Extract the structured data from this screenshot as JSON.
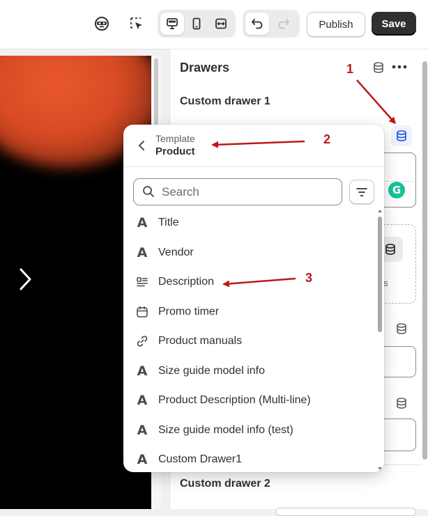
{
  "toolbar": {
    "publish_label": "Publish",
    "save_label": "Save",
    "icons": [
      "incognito-icon",
      "select-cursor-icon",
      "desktop-icon",
      "mobile-icon",
      "fullwidth-icon",
      "undo-icon",
      "redo-icon"
    ]
  },
  "sidebar": {
    "title": "Drawers",
    "section1": "Custom drawer 1",
    "section2": "Custom drawer 2",
    "dashed_text": "s"
  },
  "popover": {
    "breadcrumb_parent": "Template",
    "breadcrumb_current": "Product",
    "search_placeholder": "Search",
    "items": [
      {
        "label": "Title",
        "icon": "text-a-icon"
      },
      {
        "label": "Vendor",
        "icon": "text-a-icon"
      },
      {
        "label": "Description",
        "icon": "paragraph-icon"
      },
      {
        "label": "Promo timer",
        "icon": "calendar-icon"
      },
      {
        "label": "Product manuals",
        "icon": "link-icon"
      },
      {
        "label": "Size guide model info",
        "icon": "text-a-icon"
      },
      {
        "label": "Product Description (Multi-line)",
        "icon": "text-a-icon"
      },
      {
        "label": "Size guide model info (test)",
        "icon": "text-a-icon"
      },
      {
        "label": "Custom Drawer1",
        "icon": "text-a-icon"
      }
    ]
  },
  "annotations": {
    "n1": "1",
    "n2": "2",
    "n3": "3",
    "color": "#c0161b"
  },
  "colors": {
    "accent_blue": "#2c5de5",
    "dark_button": "#303030"
  }
}
